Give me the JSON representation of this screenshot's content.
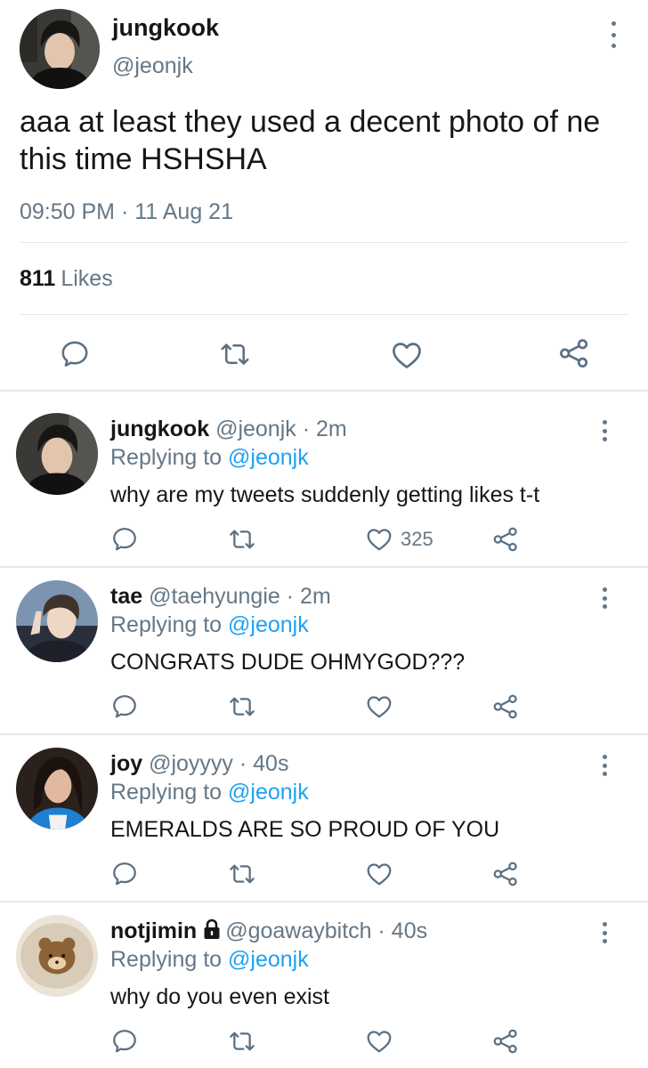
{
  "main_tweet": {
    "name": "jungkook",
    "handle": "@jeonjk",
    "text": "aaa at least they used a decent photo of ne this time HSHSHA",
    "time": "09:50 PM · 11 Aug 21",
    "likes_count": "811",
    "likes_label": "Likes",
    "avatar_icon": "avatar-photo",
    "more_icon": "more-vertical-icon"
  },
  "replies": [
    {
      "name": "jungkook",
      "handle": "@jeonjk",
      "time": "· 2m",
      "replying_label": "Replying to",
      "replying_to": "@jeonjk",
      "text": "why are my tweets suddenly getting likes t-t",
      "like_count": "325"
    },
    {
      "name": "tae",
      "handle": "@taehyungie",
      "time": "· 2m",
      "replying_label": "Replying to",
      "replying_to": "@jeonjk",
      "text": "CONGRATS DUDE OHMYGOD???",
      "like_count": ""
    },
    {
      "name": "joy",
      "handle": "@joyyyy",
      "time": "· 40s",
      "replying_label": "Replying to",
      "replying_to": "@jeonjk",
      "text": "EMERALDS ARE SO PROUD OF YOU",
      "like_count": ""
    },
    {
      "name": "notjimin",
      "handle": "@goawaybitch",
      "time": "· 40s",
      "replying_label": "Replying to",
      "replying_to": "@jeonjk",
      "text": "why do you even exist",
      "like_count": "",
      "protected": true
    }
  ],
  "colors": {
    "text": "#14171a",
    "muted": "#657786",
    "link": "#1da1f2",
    "divider": "#e1e8ed",
    "icon": "#5b7083"
  }
}
